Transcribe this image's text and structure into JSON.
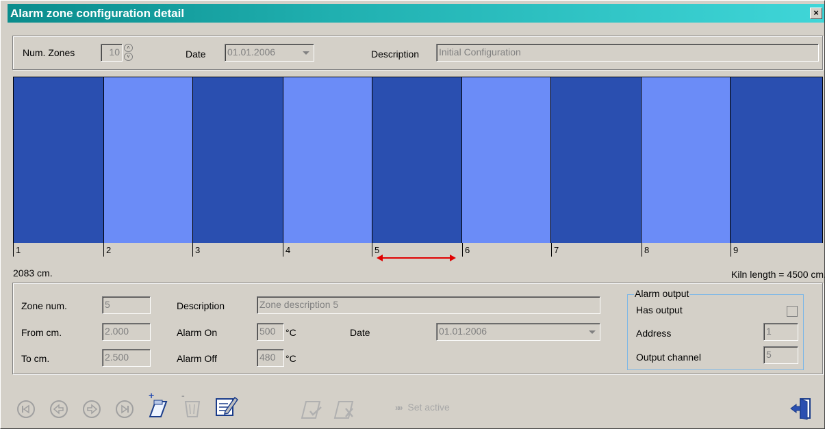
{
  "window": {
    "title": "Alarm zone configuration detail",
    "close_label": "×"
  },
  "header": {
    "num_zones_label": "Num. Zones",
    "num_zones_value": "10",
    "date_label": "Date",
    "date_value": "01.01.2006",
    "description_label": "Description",
    "description_value": "Initial Configuration"
  },
  "zones": {
    "colors": {
      "dark": "#2a4fb0",
      "light": "#6b8cf7"
    },
    "labels": [
      "1",
      "2",
      "3",
      "4",
      "5",
      "6",
      "7",
      "8",
      "9"
    ],
    "position_text": "2083 cm.",
    "kiln_length_text": "Kiln length = 4500 cm."
  },
  "detail": {
    "zone_num_label": "Zone num.",
    "zone_num_value": "5",
    "from_label": "From cm.",
    "from_value": "2.000",
    "to_label": "To cm.",
    "to_value": "2.500",
    "description_label": "Description",
    "description_value": "Zone description 5",
    "alarm_on_label": "Alarm On",
    "alarm_on_value": "500",
    "alarm_off_label": "Alarm Off",
    "alarm_off_value": "480",
    "unit": "°C",
    "date_label": "Date",
    "date_value": "01.01.2006"
  },
  "alarm_output": {
    "legend": "Alarm output",
    "has_output_label": "Has output",
    "address_label": "Address",
    "address_value": "1",
    "channel_label": "Output channel",
    "channel_value": "5"
  },
  "toolbar": {
    "set_active_label": "Set active",
    "icons": [
      "first-record-icon",
      "previous-record-icon",
      "next-record-icon",
      "last-record-icon",
      "new-record-icon",
      "delete-record-icon",
      "edit-record-icon",
      "confirm-icon",
      "cancel-icon",
      "exit-icon"
    ]
  },
  "colors": {
    "titlebar_start": "#0a8c8c",
    "titlebar_end": "#3fd6d8",
    "face": "#d4d0c8",
    "disabled_text": "#808080",
    "arrow_red": "#e00000",
    "groupbox_blue": "#7fb8e6"
  }
}
